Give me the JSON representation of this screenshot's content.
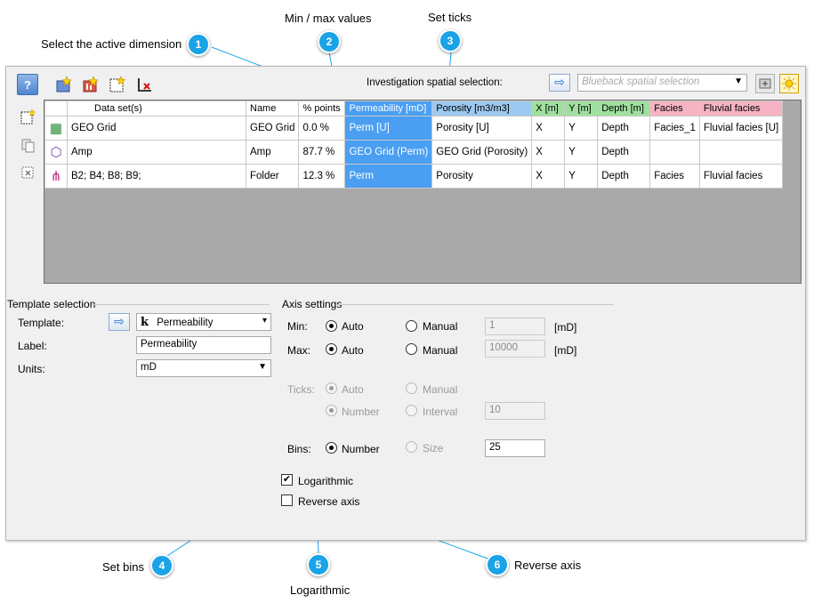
{
  "callouts": {
    "c1": {
      "num": "1",
      "label": "Select the active dimension"
    },
    "c2": {
      "num": "2",
      "label": "Min / max values"
    },
    "c3": {
      "num": "3",
      "label": "Set ticks"
    },
    "c4": {
      "num": "4",
      "label": "Set bins"
    },
    "c5": {
      "num": "5",
      "label": "Logarithmic"
    },
    "c6": {
      "num": "6",
      "label": "Reverse axis"
    }
  },
  "toolbar": {
    "help": "?",
    "investigation_label": "Investigation spatial selection:",
    "spatial_placeholder": "Blueback spatial selection"
  },
  "grid": {
    "headers": [
      "Data set(s)",
      "Name",
      "% points",
      "Permeability [mD]",
      "Porosity [m3/m3]",
      "X [m]",
      "Y [m]",
      "Depth [m]",
      "Facies",
      "Fluvial facies"
    ],
    "rows": [
      {
        "icon": "▦",
        "cells": [
          "GEO Grid",
          "GEO Grid",
          "0.0 %",
          "Perm [U]",
          "Porosity [U]",
          "X",
          "Y",
          "Depth",
          "Facies_1",
          "Fluvial facies [U]"
        ]
      },
      {
        "icon": "⬡",
        "cells": [
          "Amp",
          "Amp",
          "87.7 %",
          "GEO Grid (Perm)",
          "GEO Grid (Porosity)",
          "X",
          "Y",
          "Depth",
          "",
          ""
        ]
      },
      {
        "icon": "⋔",
        "cells": [
          "B2; B4; B8; B9;",
          "Folder",
          "12.3 %",
          "Perm",
          "Porosity",
          "X",
          "Y",
          "Depth",
          "Facies",
          "Fluvial facies"
        ]
      }
    ]
  },
  "template": {
    "group_title": "Template selection",
    "template_label": "Template:",
    "template_value": "Permeability",
    "label_label": "Label:",
    "label_value": "Permeability",
    "units_label": "Units:",
    "units_value": "mD"
  },
  "axis": {
    "group_title": "Axis settings",
    "min_label": "Min:",
    "max_label": "Max:",
    "ticks_label": "Ticks:",
    "bins_label": "Bins:",
    "auto": "Auto",
    "manual": "Manual",
    "number": "Number",
    "interval": "Interval",
    "size": "Size",
    "min_value": "1",
    "max_value": "10000",
    "unit": "[mD]",
    "interval_value": "10",
    "bins_value": "25",
    "logarithmic": "Logarithmic",
    "reverse_axis": "Reverse axis"
  },
  "colors": {
    "accent": "#1aa3e6",
    "selected_column": "#4a9ff2",
    "porosity_column": "#9cc9ef",
    "xyz_columns": "#9fe09f",
    "facies_columns": "#f5b3c3"
  }
}
